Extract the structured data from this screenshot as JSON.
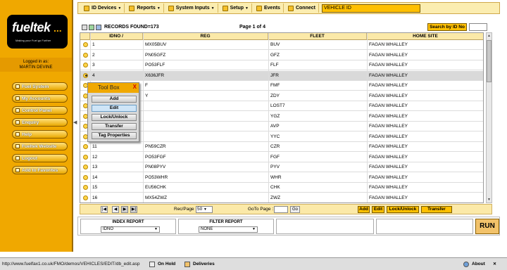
{
  "colors": {
    "accent": "#f0a800",
    "highlight": "#ffc000",
    "selected_row": "#d9d9d9"
  },
  "sidebar": {
    "logo_text": "fueltek",
    "logo_dots": "...",
    "logo_tagline": "Making your Fuel go Further",
    "logged_in_label": "Logged in as:",
    "user": "MARTIN DEVINE",
    "nav": [
      "Fuel System",
      "My Accounts",
      "Control Panel",
      "Enquiry",
      "Help",
      "Fueltek Website",
      "Logout",
      "Add to Favorites"
    ]
  },
  "toolbar": {
    "id_devices": "ID Devices",
    "reports": "Reports",
    "system_inputs": "System Inputs",
    "setup": "Setup",
    "events": "Events",
    "connect": "Connect",
    "vehicle_id": "VEHICLE ID"
  },
  "grid_info": {
    "records_found": "RECORDS FOUND=173",
    "page": "Page 1 of 4",
    "search_button": "Search by ID No"
  },
  "table": {
    "columns": [
      "IDNO",
      "REG",
      "FLEET",
      "HOME SITE"
    ],
    "rows": [
      {
        "idno": "1",
        "reg": "MX05BUV",
        "fleet": "BUV",
        "site": "FAGAN WHALLEY"
      },
      {
        "idno": "2",
        "reg": "PN05GFZ",
        "fleet": "GFZ",
        "site": "FAGAN WHALLEY"
      },
      {
        "idno": "3",
        "reg": "PO53FLF",
        "fleet": "FLF",
        "site": "FAGAN WHALLEY"
      },
      {
        "idno": "4",
        "reg": "X636JFR",
        "fleet": "JFR",
        "site": "FAGAN WHALLEY"
      },
      {
        "idno": "",
        "reg": "F",
        "fleet": "FMF",
        "site": "FAGAN WHALLEY"
      },
      {
        "idno": "",
        "reg": "Y",
        "fleet": "ZDY",
        "site": "FAGAN WHALLEY"
      },
      {
        "idno": "",
        "reg": "",
        "fleet": "LOST7",
        "site": "FAGAN WHALLEY"
      },
      {
        "idno": "",
        "reg": "",
        "fleet": "YGZ",
        "site": "FAGAN WHALLEY"
      },
      {
        "idno": "",
        "reg": "",
        "fleet": "AVP",
        "site": "FAGAN WHALLEY"
      },
      {
        "idno": "",
        "reg": "",
        "fleet": "YYC",
        "site": "FAGAN WHALLEY"
      },
      {
        "idno": "11",
        "reg": "PN59CZR",
        "fleet": "CZR",
        "site": "FAGAN WHALLEY"
      },
      {
        "idno": "12",
        "reg": "PO53FGF",
        "fleet": "FGF",
        "site": "FAGAN WHALLEY"
      },
      {
        "idno": "13",
        "reg": "PN08PYV",
        "fleet": "PYV",
        "site": "FAGAN WHALLEY"
      },
      {
        "idno": "14",
        "reg": "PO53WHR",
        "fleet": "WHR",
        "site": "FAGAN WHALLEY"
      },
      {
        "idno": "15",
        "reg": "EU56CHK",
        "fleet": "CHK",
        "site": "FAGAN WHALLEY"
      },
      {
        "idno": "16",
        "reg": "MX54ZWZ",
        "fleet": "ZWZ",
        "site": "FAGAN WHALLEY"
      }
    ],
    "selected_row": 3
  },
  "toolbox": {
    "title": "Tool Box",
    "close": "X",
    "buttons": [
      "Add",
      "Edit",
      "Lock/Unlock",
      "Transfer",
      "Tag Properties"
    ]
  },
  "pager": {
    "rec_page_label": "Rec/Page",
    "rec_page_value": "50",
    "goto_label": "GoTo Page :",
    "go": "Go",
    "actions": [
      "Add",
      "Edit",
      "Lock/Unlock",
      "Transfer"
    ]
  },
  "reports": {
    "index_label": "INDEX REPORT",
    "index_value": "IDNO",
    "filter_label": "FILTER REPORT",
    "filter_value": "NONE",
    "run": "RUN"
  },
  "statusbar": {
    "url": "http://www.fuelfax1.co.uk/FMO/demos/VEHICLES/EDIT/db_edit.asp",
    "on_hold": "On Hold",
    "deliveries": "Deliveries",
    "about": "About"
  }
}
